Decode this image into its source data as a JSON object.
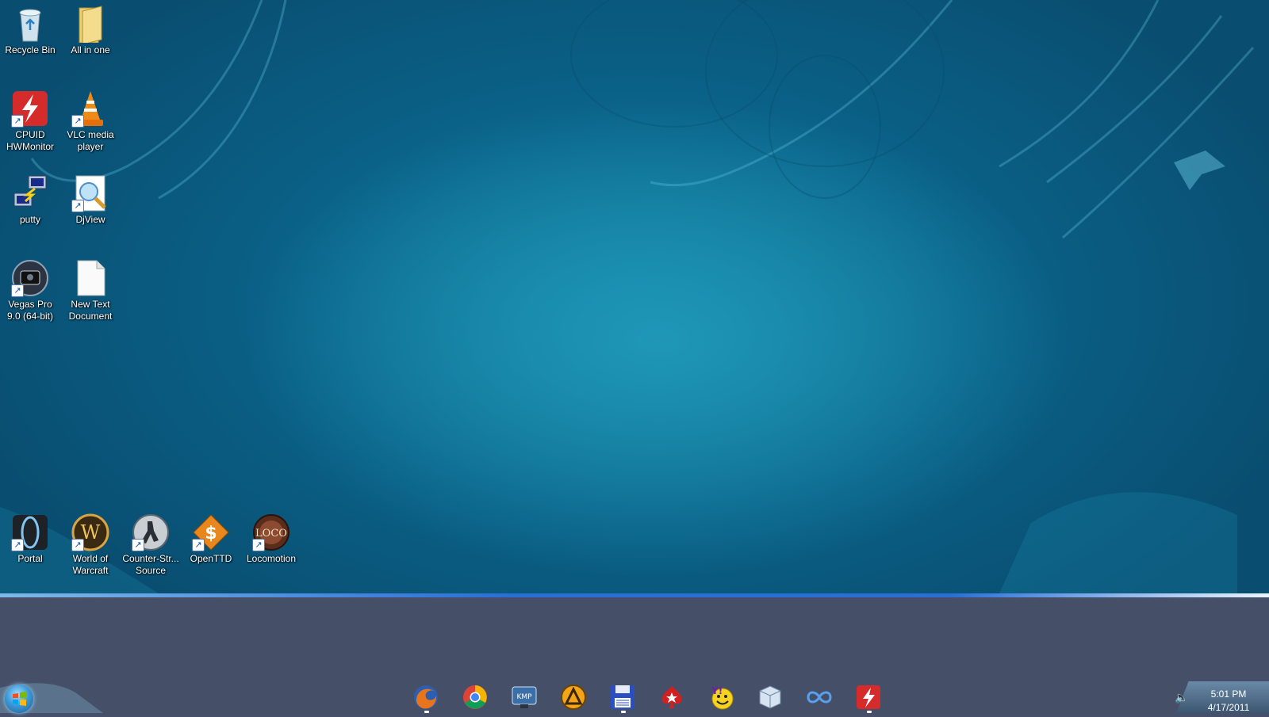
{
  "desktop": {
    "icons": [
      {
        "label": "Recycle Bin",
        "icon": "recycle-bin-icon"
      },
      {
        "label": "All in one",
        "icon": "folder-icon"
      },
      {
        "label": "CPUID\nHWMonitor",
        "icon": "hwmonitor-icon"
      },
      {
        "label": "VLC media\nplayer",
        "icon": "vlc-icon"
      },
      {
        "label": "putty",
        "icon": "putty-icon"
      },
      {
        "label": "DjView",
        "icon": "djview-icon"
      },
      {
        "label": "Vegas Pro\n9.0 (64-bit)",
        "icon": "vegas-pro-icon"
      },
      {
        "label": "New Text\nDocument",
        "icon": "text-document-icon"
      },
      {
        "label": "Portal",
        "icon": "portal-icon"
      },
      {
        "label": "World of\nWarcraft",
        "icon": "world-of-warcraft-icon"
      },
      {
        "label": "Counter-Str...\nSource",
        "icon": "counter-strike-icon"
      },
      {
        "label": "OpenTTD",
        "icon": "openttd-icon"
      },
      {
        "label": "Locomotion",
        "icon": "locomotion-icon"
      }
    ]
  },
  "taskbar": {
    "start_icon": "windows-start-orb-icon",
    "pinned": [
      {
        "icon": "firefox-icon",
        "running": true
      },
      {
        "icon": "chrome-icon",
        "running": false
      },
      {
        "icon": "kmplayer-icon",
        "running": false
      },
      {
        "icon": "aimp-icon",
        "running": false
      },
      {
        "icon": "floppy-save-icon",
        "running": true
      },
      {
        "icon": "pokerstars-icon",
        "running": false
      },
      {
        "icon": "yahoo-messenger-icon",
        "running": false
      },
      {
        "icon": "virtualbox-cube-icon",
        "running": false
      },
      {
        "icon": "infinity-icon",
        "running": false
      },
      {
        "icon": "hwmonitor-icon",
        "running": true
      }
    ],
    "tray": {
      "volume_icon": "speaker-icon",
      "time": "5:01 PM",
      "date": "4/17/2011"
    }
  },
  "colors": {
    "wallpaper": "#0f6f96",
    "taskbar": "#454f68",
    "accent_line": "#2a6fd6"
  }
}
